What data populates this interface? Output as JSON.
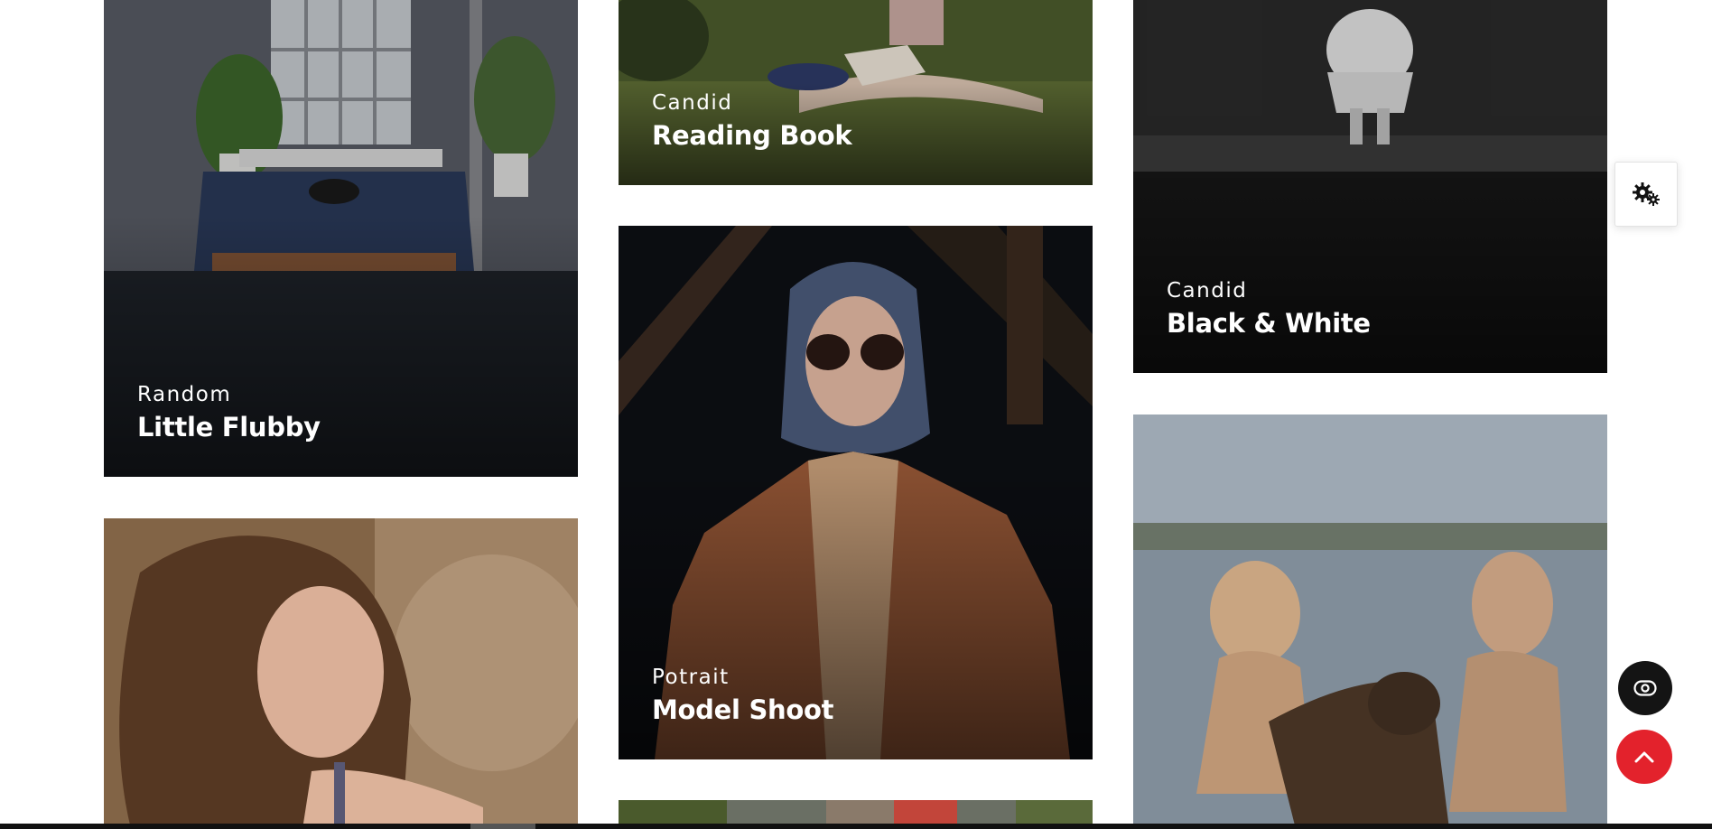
{
  "gallery": [
    {
      "category": "Random",
      "title": "Little Flubby"
    },
    {
      "category": "Candid",
      "title": "Reading Book"
    },
    {
      "category": "Candid",
      "title": "Black & White"
    },
    {
      "category": "Potrait",
      "title": "Model Shoot"
    },
    {
      "category": "",
      "title": ""
    },
    {
      "category": "",
      "title": ""
    },
    {
      "category": "",
      "title": ""
    }
  ],
  "icons": {
    "settings": "gears-icon",
    "preview": "eye-icon",
    "scroll_top": "chevron-up-icon"
  },
  "colors": {
    "accent": "#e3222c",
    "dark_button": "#141414",
    "caption_text": "#ffffff"
  }
}
